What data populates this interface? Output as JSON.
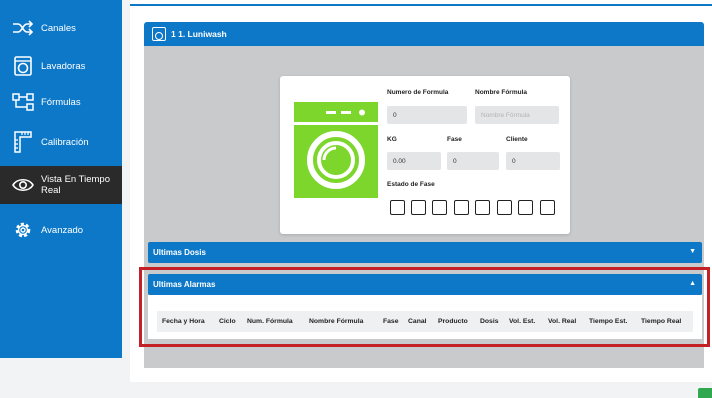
{
  "sidebar": {
    "items": [
      {
        "label": "Canales",
        "icon": "shuffle-icon"
      },
      {
        "label": "Lavadoras",
        "icon": "washing-machine-icon"
      },
      {
        "label": "Fórmulas",
        "icon": "hierarchy-icon"
      },
      {
        "label": "Calibración",
        "icon": "ruler-icon"
      },
      {
        "label": "Vista En Tiempo Real",
        "icon": "eye-icon",
        "active": true
      },
      {
        "label": "Avanzado",
        "icon": "gear-icon"
      }
    ]
  },
  "panel": {
    "title": "1 1. Luniwash"
  },
  "form": {
    "formula_number_label": "Numero de Formula",
    "formula_number_value": "0",
    "formula_name_label": "Nombre Fórmula",
    "formula_name_placeholder": "Nombre Fórmula",
    "kg_label": "KG",
    "kg_value": "0.00",
    "phase_label": "Fase",
    "phase_value": "0",
    "client_label": "Cliente",
    "client_value": "0",
    "phase_state_label": "Estado de Fase",
    "phase_box_count": 8
  },
  "sections": {
    "ultimas_dosis": {
      "title": "Ultimas Dosis",
      "caret": "▼"
    },
    "ultimas_alarmas": {
      "title": "Ultimas Alarmas",
      "caret": "▲"
    }
  },
  "alarm_table": {
    "columns": [
      "Fecha y Hora",
      "Ciclo",
      "Num. Fórmula",
      "Nombre Fórmula",
      "Fase",
      "Canal",
      "Producto",
      "Dosis",
      "Vol. Est.",
      "Vol. Real",
      "Tiempo Est.",
      "Tiempo Real"
    ]
  },
  "colors": {
    "primary": "#0d78c8",
    "sidebar_active": "#2a2a2a",
    "washer_green": "#7cd62b",
    "highlight": "#c42127"
  }
}
